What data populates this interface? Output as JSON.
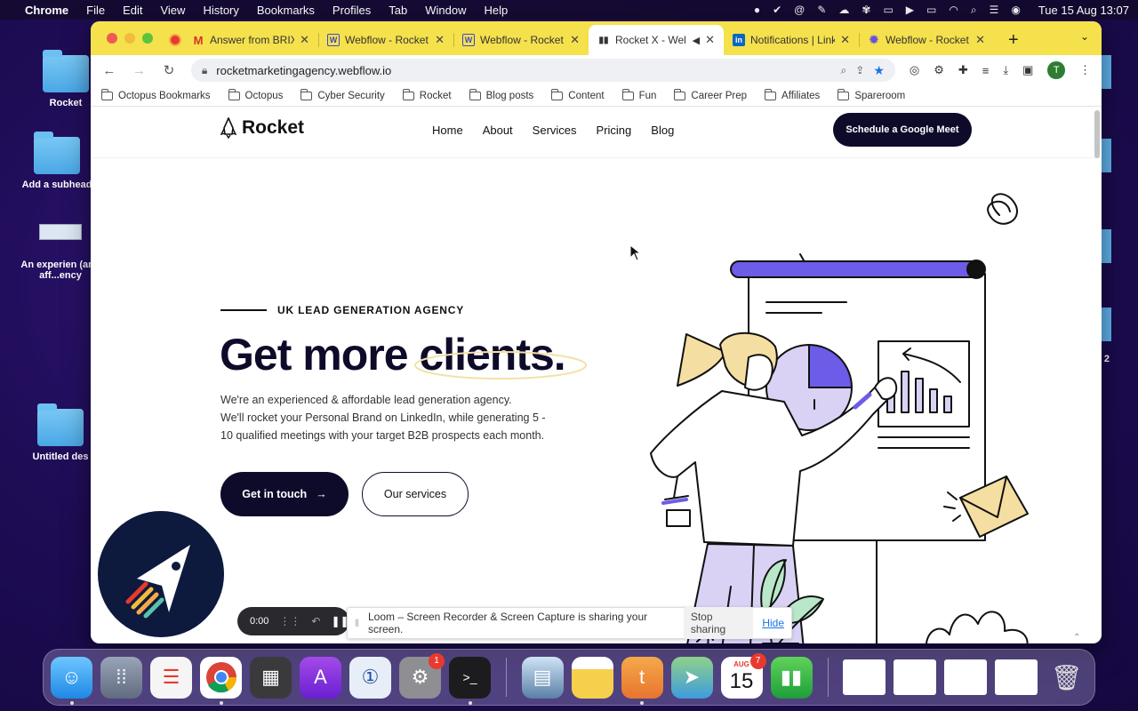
{
  "menubar": {
    "app_name": "Chrome",
    "menus": [
      "File",
      "Edit",
      "View",
      "History",
      "Bookmarks",
      "Profiles",
      "Tab",
      "Window",
      "Help"
    ],
    "clock": "Tue 15 Aug  13:07"
  },
  "desktop": {
    "icons": [
      {
        "label": "Rocket"
      },
      {
        "label": "Add a subhead"
      },
      {
        "label": "An experien (and aff...ency"
      },
      {
        "label": "Untitled des"
      }
    ],
    "right_edge_label": "2"
  },
  "browser": {
    "tabs": [
      {
        "title": "Answer from BRIX",
        "icon": "gmail-icon"
      },
      {
        "title": "Webflow - Rocket",
        "icon": "webflow-icon"
      },
      {
        "title": "Webflow - Rocket",
        "icon": "webflow-icon"
      },
      {
        "title": "Rocket X - Wel",
        "icon": "analytics-icon",
        "active": true
      },
      {
        "title": "Notifications | Link",
        "icon": "linkedin-icon"
      },
      {
        "title": "Webflow - Rocket",
        "icon": "webflow-settings-icon"
      }
    ],
    "url": "rocketmarketingagency.webflow.io",
    "profile_initial": "T",
    "bookmarks": [
      "Octopus Bookmarks",
      "Octopus",
      "Cyber Security",
      "Rocket",
      "Blog posts",
      "Content",
      "Fun",
      "Career Prep",
      "Affiliates",
      "Spareroom"
    ]
  },
  "site": {
    "logo_text": "Rocket",
    "nav": [
      "Home",
      "About",
      "Services",
      "Pricing",
      "Blog"
    ],
    "cta_top": "Schedule a Google Meet",
    "eyebrow": "UK LEAD GENERATION AGENCY",
    "headline_main": "Get more ",
    "headline_accent": "clients.",
    "intro_lines": [
      "We're an experienced & affordable lead generation agency.",
      "We'll rocket your Personal Brand on LinkedIn, while generating 5 -",
      "10 qualified meetings with your target B2B prospects each month."
    ],
    "btn_primary": "Get in touch",
    "btn_secondary": "Our services"
  },
  "loom": {
    "timer": "0:00",
    "share_message": "Loom – Screen Recorder & Screen Capture is sharing your screen.",
    "stop_label": "Stop sharing",
    "hide_label": "Hide"
  },
  "dock": {
    "calendar_month": "AUG",
    "calendar_day": "15",
    "calendar_badge": "7",
    "settings_badge": "1"
  },
  "colors": {
    "tabstrip": "#f5e14c",
    "brand_dark": "#0e0b2a",
    "accent_purple": "#6c5ce7",
    "lavender": "#d9d2f5"
  }
}
